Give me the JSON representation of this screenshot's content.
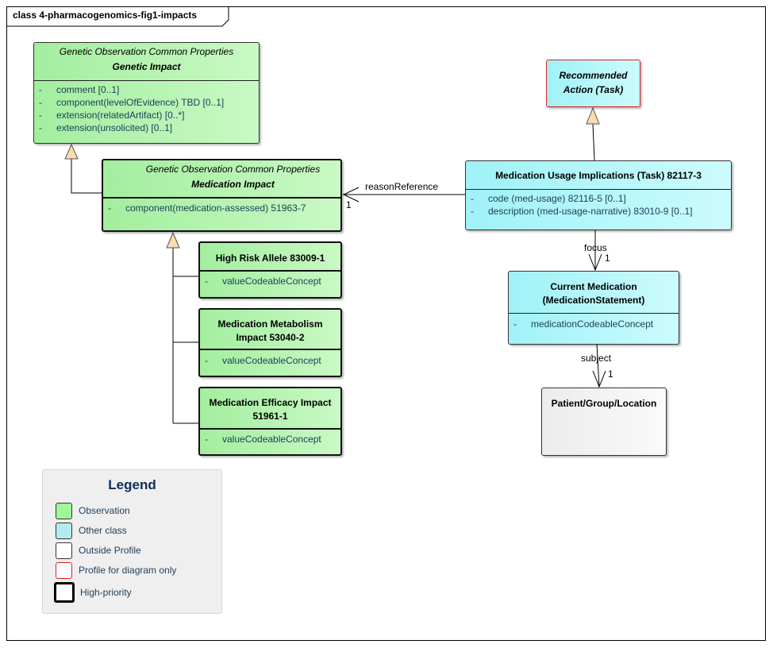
{
  "diagram": {
    "title": "class 4-pharmacogenomics-fig1-impacts"
  },
  "classes": {
    "genetic_impact": {
      "stereotype": "Genetic Observation Common Properties",
      "name": "Genetic Impact",
      "category": "Observation",
      "attributes": [
        {
          "visibility": "-",
          "text": "comment [0..1]"
        },
        {
          "visibility": "-",
          "text": "component(levelOfEvidence) TBD [0..1]"
        },
        {
          "visibility": "-",
          "text": "extension(relatedArtifact) [0..*]"
        },
        {
          "visibility": "-",
          "text": "extension(unsolicited) [0..1]"
        }
      ]
    },
    "medication_impact": {
      "stereotype": "Genetic Observation Common Properties",
      "name": "Medication Impact",
      "category": "Observation",
      "high_priority": true,
      "attributes": [
        {
          "visibility": "-",
          "text": "component(medication-assessed) 51963-7"
        }
      ]
    },
    "high_risk_allele": {
      "name": "High Risk Allele 83009-1",
      "category": "Observation",
      "high_priority": true,
      "attributes": [
        {
          "visibility": "-",
          "text": "valueCodeableConcept"
        }
      ]
    },
    "medication_metabolism": {
      "name_line1": "Medication Metabolism",
      "name_line2": "Impact 53040-2",
      "category": "Observation",
      "high_priority": true,
      "attributes": [
        {
          "visibility": "-",
          "text": "valueCodeableConcept"
        }
      ]
    },
    "medication_efficacy": {
      "name_line1": "Medication Efficacy Impact",
      "name_line2": "51961-1",
      "category": "Observation",
      "high_priority": true,
      "attributes": [
        {
          "visibility": "-",
          "text": "valueCodeableConcept"
        }
      ]
    },
    "recommended_action": {
      "name_line1": "Recommended",
      "name_line2": "Action (Task)",
      "category": "Profile for diagram only"
    },
    "medication_usage_implications": {
      "name": "Medication Usage Implications (Task) 82117-3",
      "category": "Other class",
      "attributes": [
        {
          "visibility": "-",
          "text": "code (med-usage) 82116-5 [0..1]"
        },
        {
          "visibility": "-",
          "text": "description (med-usage-narrative) 83010-9 [0..1]"
        }
      ]
    },
    "current_medication": {
      "name_line1": "Current Medication",
      "name_line2": "(MedicationStatement)",
      "category": "Other class",
      "attributes": [
        {
          "visibility": "-",
          "text": "medicationCodeableConcept"
        }
      ]
    },
    "patient_group_location": {
      "name": "Patient/Group/Location",
      "category": "Outside Profile"
    }
  },
  "relationships": [
    {
      "type": "generalization",
      "from": "Medication Impact",
      "to": "Genetic Impact"
    },
    {
      "type": "generalization",
      "from": "High Risk Allele 83009-1",
      "to": "Medication Impact"
    },
    {
      "type": "generalization",
      "from": "Medication Metabolism Impact 53040-2",
      "to": "Medication Impact"
    },
    {
      "type": "generalization",
      "from": "Medication Efficacy Impact 51961-1",
      "to": "Medication Impact"
    },
    {
      "type": "generalization",
      "from": "Medication Usage Implications (Task) 82117-3",
      "to": "Recommended Action (Task)"
    },
    {
      "type": "association",
      "from": "Medication Usage Implications (Task) 82117-3",
      "to": "Medication Impact",
      "role": "reasonReference",
      "multiplicity": "1"
    },
    {
      "type": "association",
      "from": "Medication Usage Implications (Task) 82117-3",
      "to": "Current Medication (MedicationStatement)",
      "role": "focus",
      "multiplicity": "1"
    },
    {
      "type": "association",
      "from": "Current Medication (MedicationStatement)",
      "to": "Patient/Group/Location",
      "role": "subject",
      "multiplicity": "1"
    }
  ],
  "labels": {
    "reason_reference": "reasonReference",
    "reason_reference_mult": "1",
    "focus": "focus",
    "focus_mult": "1",
    "subject": "subject",
    "subject_mult": "1"
  },
  "legend": {
    "title": "Legend",
    "items": [
      {
        "label": "Observation",
        "color": "#9ef89a"
      },
      {
        "label": "Other class",
        "color": "#b3ecef"
      },
      {
        "label": "Outside Profile",
        "color": "#ffffff"
      },
      {
        "label": "Profile for diagram only",
        "color": "#ffffff",
        "border": "#e02020"
      },
      {
        "label": "High-priority",
        "color": "#ffffff",
        "border": "#000000"
      }
    ]
  },
  "colors": {
    "observation": "#a3ee9f",
    "other_class": "#9ff2f7",
    "outside_profile": "#f2f2f2",
    "diagram_only_border": "#e02020",
    "generalization_arrow_fill": "#f8ddb0",
    "legend_title": "#0e2d5a",
    "attribute_text": "#1c3d5a"
  }
}
